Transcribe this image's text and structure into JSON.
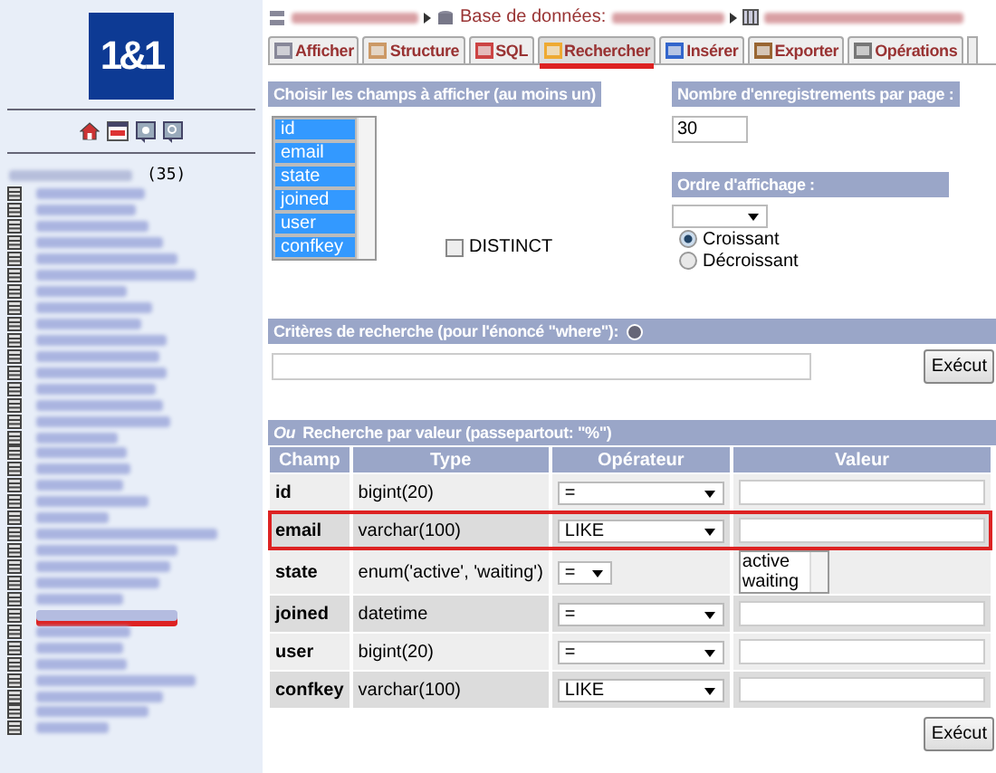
{
  "sidebar": {
    "logo": "1&1",
    "count": "(35)",
    "tables": [
      {
        "highlighted": false
      },
      {
        "highlighted": false
      },
      {
        "highlighted": false
      },
      {
        "highlighted": false
      },
      {
        "highlighted": false
      },
      {
        "highlighted": false
      },
      {
        "highlighted": false
      },
      {
        "highlighted": false
      },
      {
        "highlighted": false
      },
      {
        "highlighted": false
      },
      {
        "highlighted": false
      },
      {
        "highlighted": false
      },
      {
        "highlighted": false
      },
      {
        "highlighted": false
      },
      {
        "highlighted": false
      },
      {
        "highlighted": false
      },
      {
        "highlighted": false
      },
      {
        "highlighted": false
      },
      {
        "highlighted": false
      },
      {
        "highlighted": false
      },
      {
        "highlighted": false
      },
      {
        "highlighted": false
      },
      {
        "highlighted": false
      },
      {
        "highlighted": false
      },
      {
        "highlighted": false
      },
      {
        "highlighted": false
      },
      {
        "highlighted": true
      },
      {
        "highlighted": false
      },
      {
        "highlighted": false
      },
      {
        "highlighted": false
      },
      {
        "highlighted": false
      },
      {
        "highlighted": false
      },
      {
        "highlighted": false
      },
      {
        "highlighted": false
      }
    ]
  },
  "breadcrumb": {
    "database_label": "Base de données:"
  },
  "tabs": [
    {
      "label": "Afficher",
      "selected": false
    },
    {
      "label": "Structure",
      "selected": false
    },
    {
      "label": "SQL",
      "selected": false
    },
    {
      "label": "Rechercher",
      "selected": true
    },
    {
      "label": "Insérer",
      "selected": false
    },
    {
      "label": "Exporter",
      "selected": false
    },
    {
      "label": "Opérations",
      "selected": false
    }
  ],
  "fields_panel": {
    "title": "Choisir les champs à afficher (au moins un)",
    "options": [
      {
        "label": "id",
        "selected": true
      },
      {
        "label": "email",
        "selected": true
      },
      {
        "label": "state",
        "selected": true
      },
      {
        "label": "joined",
        "selected": true
      },
      {
        "label": "user",
        "selected": true
      },
      {
        "label": "confkey",
        "selected": true
      }
    ],
    "distinct": {
      "label": "DISTINCT",
      "checked": false
    }
  },
  "per_page": {
    "title": "Nombre d'enregistrements par page :",
    "value": "30"
  },
  "order": {
    "title": "Ordre d'affichage :",
    "options": [
      {
        "label": "Croissant",
        "selected": true
      },
      {
        "label": "Décroissant",
        "selected": false
      }
    ]
  },
  "criteria": {
    "title": "Critères de recherche (pour l'énoncé \"where\"):",
    "button": "Exécut"
  },
  "value_search": {
    "title": "*Ou* Recherche par valeur (passepartout: \"%\")",
    "columns": [
      "Champ",
      "Type",
      "Opérateur",
      "Valeur"
    ],
    "rows": [
      {
        "field": "id",
        "type": "bigint(20)",
        "operator": "=",
        "kind": "input",
        "highlighted": false
      },
      {
        "field": "email",
        "type": "varchar(100)",
        "operator": "LIKE",
        "kind": "input",
        "highlighted": true
      },
      {
        "field": "state",
        "type": "enum('active', 'waiting')",
        "operator": "=",
        "kind": "listbox",
        "options": [
          "active",
          "waiting"
        ],
        "highlighted": false
      },
      {
        "field": "joined",
        "type": "datetime",
        "operator": "=",
        "kind": "input",
        "highlighted": false
      },
      {
        "field": "user",
        "type": "bigint(20)",
        "operator": "=",
        "kind": "input",
        "highlighted": false
      },
      {
        "field": "confkey",
        "type": "varchar(100)",
        "operator": "LIKE",
        "kind": "input",
        "highlighted": false
      }
    ],
    "button": "Exécut"
  }
}
